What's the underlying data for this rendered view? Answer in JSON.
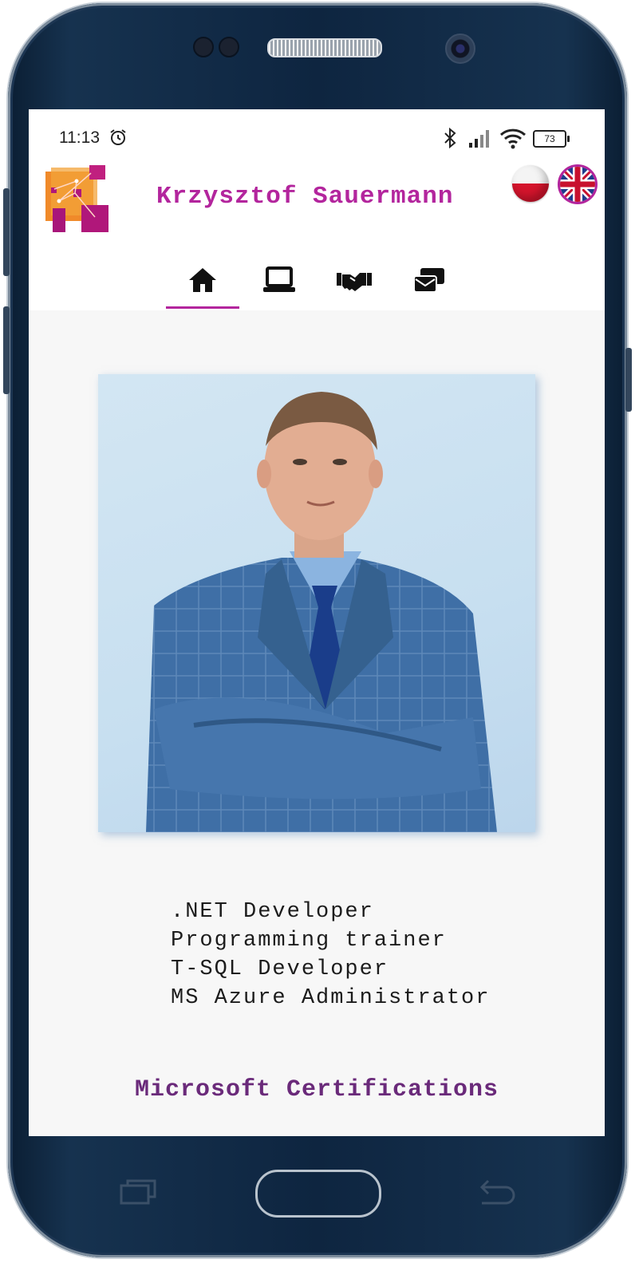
{
  "status_bar": {
    "time": "11:13",
    "battery": "73"
  },
  "header": {
    "site_name": "Krzysztof Sauermann",
    "languages": [
      "pl",
      "en"
    ]
  },
  "nav": {
    "items": [
      {
        "icon": "home-icon",
        "active": true
      },
      {
        "icon": "laptop-icon",
        "active": false
      },
      {
        "icon": "handshake-icon",
        "active": false
      },
      {
        "icon": "contact-cards-icon",
        "active": false
      }
    ]
  },
  "roles": [
    ".NET Developer",
    "Programming trainer",
    "T-SQL Developer",
    "MS Azure Administrator"
  ],
  "certifications_title": "Microsoft Certifications",
  "colors": {
    "accent": "#b3259d",
    "cert_title": "#6a2a7a"
  }
}
